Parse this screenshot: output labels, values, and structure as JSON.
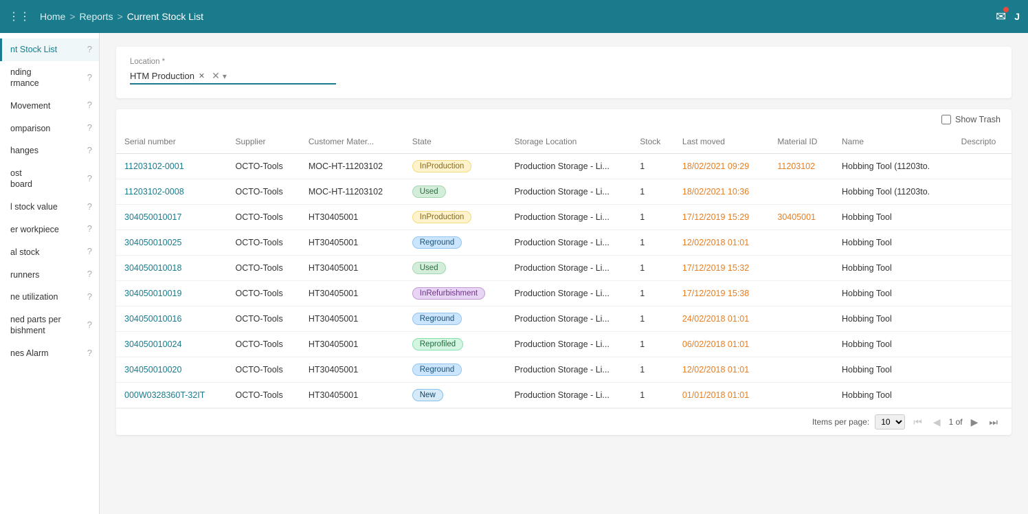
{
  "topbar": {
    "grid_icon": "⊞",
    "breadcrumb": {
      "home": "Home",
      "sep1": ">",
      "reports": "Reports",
      "sep2": ">",
      "current": "Current Stock List"
    },
    "mail_icon": "✉"
  },
  "sidebar": {
    "items": [
      {
        "id": "current-stock-list",
        "label": "nt Stock List",
        "active": true
      },
      {
        "id": "pending-performance",
        "label": "nding rmance",
        "active": false
      },
      {
        "id": "movement",
        "label": "Movement",
        "active": false
      },
      {
        "id": "comparison",
        "label": "omparison",
        "active": false
      },
      {
        "id": "changes",
        "label": "hanges",
        "active": false
      },
      {
        "id": "cost-board",
        "label": "ost board",
        "active": false
      },
      {
        "id": "stock-value",
        "label": "l stock value",
        "active": false
      },
      {
        "id": "per-workpiece",
        "label": "er workpiece",
        "active": false
      },
      {
        "id": "al-stock",
        "label": "al stock",
        "active": false
      },
      {
        "id": "runners",
        "label": "runners",
        "active": false
      },
      {
        "id": "ne-utilization",
        "label": "ne utilization",
        "active": false
      },
      {
        "id": "ned-parts-per",
        "label": "ned parts per bishment",
        "active": false
      },
      {
        "id": "nes-alarm",
        "label": "nes Alarm",
        "active": false
      }
    ]
  },
  "filter": {
    "location_label": "Location *",
    "selected_value": "HTM Production"
  },
  "show_trash": {
    "label": "Show Trash",
    "checked": false
  },
  "table": {
    "columns": [
      "Serial number",
      "Supplier",
      "Customer Mater...",
      "State",
      "Storage Location",
      "Stock",
      "Last moved",
      "Material ID",
      "Name",
      "Descripto"
    ],
    "rows": [
      {
        "serial": "11203102-0001",
        "supplier": "OCTO-Tools",
        "customer_mat": "MOC-HT-11203102",
        "state": "InProduction",
        "state_class": "badge-inproduction",
        "storage": "Production Storage - Li...",
        "stock": "1",
        "last_moved": "18/02/2021 09:29",
        "material_id": "11203102",
        "name": "Hobbing Tool (11203to.",
        "description": ""
      },
      {
        "serial": "11203102-0008",
        "supplier": "OCTO-Tools",
        "customer_mat": "MOC-HT-11203102",
        "state": "Used",
        "state_class": "badge-used",
        "storage": "Production Storage - Li...",
        "stock": "1",
        "last_moved": "18/02/2021 10:36",
        "material_id": "",
        "name": "Hobbing Tool (11203to.",
        "description": ""
      },
      {
        "serial": "304050010017",
        "supplier": "OCTO-Tools",
        "customer_mat": "HT30405001",
        "state": "InProduction",
        "state_class": "badge-inproduction",
        "storage": "Production Storage - Li...",
        "stock": "1",
        "last_moved": "17/12/2019 15:29",
        "material_id": "30405001",
        "name": "Hobbing Tool",
        "description": ""
      },
      {
        "serial": "304050010025",
        "supplier": "OCTO-Tools",
        "customer_mat": "HT30405001",
        "state": "Reground",
        "state_class": "badge-reground",
        "storage": "Production Storage - Li...",
        "stock": "1",
        "last_moved": "12/02/2018 01:01",
        "material_id": "",
        "name": "Hobbing Tool",
        "description": ""
      },
      {
        "serial": "304050010018",
        "supplier": "OCTO-Tools",
        "customer_mat": "HT30405001",
        "state": "Used",
        "state_class": "badge-used",
        "storage": "Production Storage - Li...",
        "stock": "1",
        "last_moved": "17/12/2019 15:32",
        "material_id": "",
        "name": "Hobbing Tool",
        "description": ""
      },
      {
        "serial": "304050010019",
        "supplier": "OCTO-Tools",
        "customer_mat": "HT30405001",
        "state": "InRefurbishment",
        "state_class": "badge-inrefurbishment",
        "storage": "Production Storage - Li...",
        "stock": "1",
        "last_moved": "17/12/2019 15:38",
        "material_id": "",
        "name": "Hobbing Tool",
        "description": ""
      },
      {
        "serial": "304050010016",
        "supplier": "OCTO-Tools",
        "customer_mat": "HT30405001",
        "state": "Reground",
        "state_class": "badge-reground",
        "storage": "Production Storage - Li...",
        "stock": "1",
        "last_moved": "24/02/2018 01:01",
        "material_id": "",
        "name": "Hobbing Tool",
        "description": ""
      },
      {
        "serial": "304050010024",
        "supplier": "OCTO-Tools",
        "customer_mat": "HT30405001",
        "state": "Reprofiled",
        "state_class": "badge-reprofiled",
        "storage": "Production Storage - Li...",
        "stock": "1",
        "last_moved": "06/02/2018 01:01",
        "material_id": "",
        "name": "Hobbing Tool",
        "description": ""
      },
      {
        "serial": "304050010020",
        "supplier": "OCTO-Tools",
        "customer_mat": "HT30405001",
        "state": "Reground",
        "state_class": "badge-reground",
        "storage": "Production Storage - Li...",
        "stock": "1",
        "last_moved": "12/02/2018 01:01",
        "material_id": "",
        "name": "Hobbing Tool",
        "description": ""
      },
      {
        "serial": "000W0328360T-32IT",
        "supplier": "OCTO-Tools",
        "customer_mat": "HT30405001",
        "state": "New",
        "state_class": "badge-new",
        "storage": "Production Storage - Li...",
        "stock": "1",
        "last_moved": "01/01/2018 01:01",
        "material_id": "",
        "name": "Hobbing Tool",
        "description": ""
      }
    ]
  },
  "pagination": {
    "items_per_page_label": "Items per page:",
    "items_per_page": "10",
    "page_info": "1 of",
    "first_btn": "⏮",
    "prev_btn": "◀",
    "next_btn": "▶",
    "last_btn": "⏭"
  }
}
